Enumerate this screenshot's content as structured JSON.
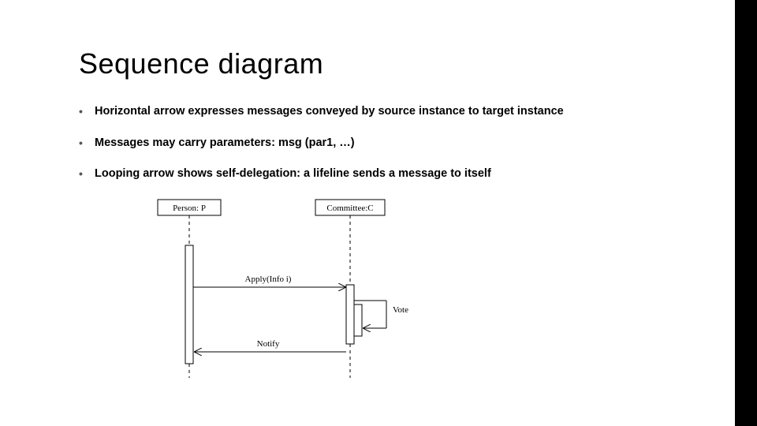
{
  "title": "Sequence diagram",
  "bullets": [
    "Horizontal arrow expresses messages conveyed by source instance to target instance",
    "Messages may carry parameters: msg (par1, …)",
    "Looping arrow shows self-delegation: a lifeline sends a message to itself"
  ],
  "diagram": {
    "lifelines": {
      "person": "Person: P",
      "committee": "Committee:C"
    },
    "messages": {
      "apply": "Apply(Info i)",
      "vote": "Vote",
      "notify": "Notify"
    }
  }
}
